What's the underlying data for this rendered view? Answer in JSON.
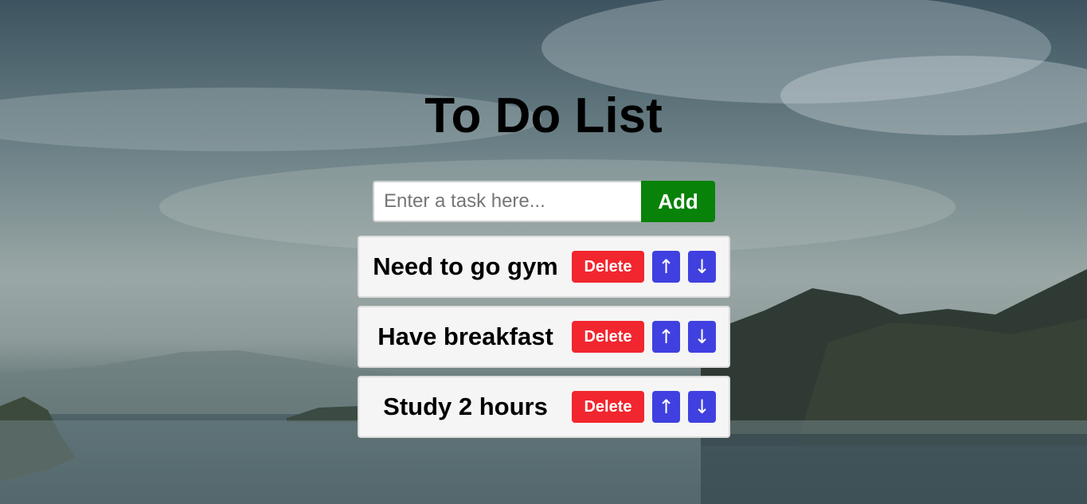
{
  "page": {
    "title": "To Do List"
  },
  "form": {
    "input_placeholder": "Enter a task here...",
    "input_value": "",
    "add_label": "Add"
  },
  "tasks": [
    {
      "text": "Need to go gym",
      "delete_label": "Delete",
      "up_label": "↑",
      "down_label": "↓"
    },
    {
      "text": "Have breakfast",
      "delete_label": "Delete",
      "up_label": "↑",
      "down_label": "↓"
    },
    {
      "text": "Study 2 hours",
      "delete_label": "Delete",
      "up_label": "↑",
      "down_label": "↓"
    }
  ],
  "colors": {
    "add_button": "#088208",
    "delete_button": "#f2262e",
    "move_button": "#4040e0",
    "task_background": "#f5f5f5"
  },
  "icons": {
    "move_up": "up-arrow-icon",
    "move_down": "down-arrow-icon"
  }
}
